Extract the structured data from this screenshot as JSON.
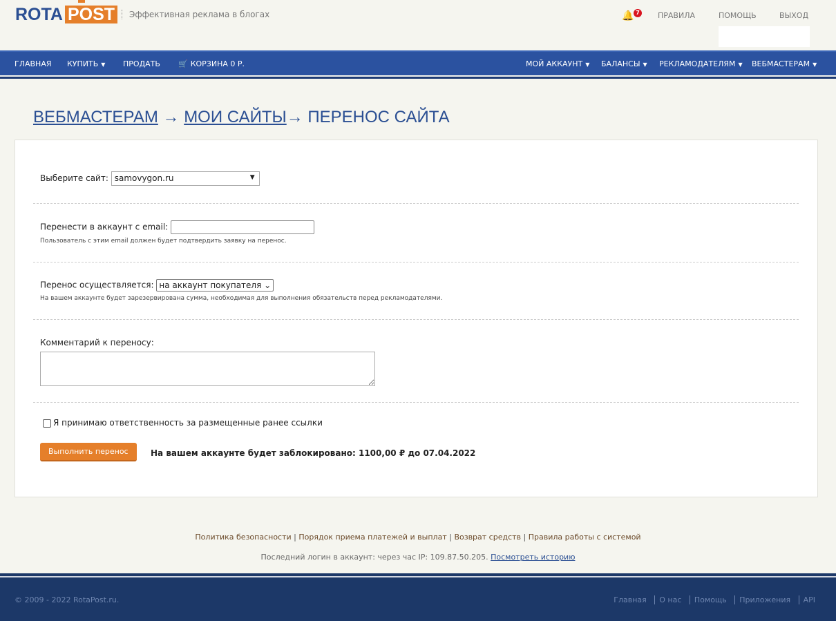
{
  "header": {
    "logo_left": "ROTA",
    "logo_right": "POST",
    "tagline": "Эффективная реклама в блогах",
    "notifications": "7",
    "links": [
      "ПРАВИЛА",
      "ПОМОЩЬ",
      "ВЫХОД"
    ]
  },
  "nav": {
    "left": [
      "ГЛАВНАЯ",
      "КУПИТЬ",
      "ПРОДАТЬ",
      "КОРЗИНА 0 Р."
    ],
    "right": [
      "МОЙ АККАУНТ",
      "БАЛАНСЫ",
      "РЕКЛАМОДАТЕЛЯМ",
      "ВЕБМАСТЕРАМ"
    ]
  },
  "breadcrumb": {
    "b1": "ВЕБМАСТЕРАМ",
    "sep1": " → ",
    "b2": "МОИ САЙТЫ",
    "sep2": "→ ПЕРЕНОС САЙТА"
  },
  "form": {
    "site_label": "Выберите сайт:",
    "site_value": "samovygon.ru",
    "email_label": "Перенести в аккаунт с email:",
    "email_value": "",
    "email_hint": "Пользователь с этим email должен будет подтвердить заявку на перенос.",
    "transfer_label": "Перенос осуществляется:",
    "transfer_value": "на аккаунт покупателя",
    "transfer_hint": "На вашем аккаунте будет зарезервирована сумма, необходимая для выполнения обязательств перед рекламодателями.",
    "comment_label": "Комментарий к переносу:",
    "comment_value": "",
    "accept_label": "Я принимаю ответственность за размещенные ранее ссылки",
    "submit": "Выполнить перенос",
    "blocked": "На вашем аккаунте будет заблокировано: 1100,00 ₽ до 07.04.2022"
  },
  "footer_links": [
    "Политика безопасности",
    "Порядок приема платежей и выплат",
    "Возврат средств",
    "Правила работы с системой"
  ],
  "last_login": {
    "text": "Последний логин в аккаунт: через час IP: 109.87.50.205.",
    "link": "Посмотреть историю"
  },
  "footer": {
    "copyright": "© 2009 - 2022 RotaPost.ru.",
    "links": [
      "Главная",
      "О нас",
      "Помощь",
      "Приложения",
      "API"
    ]
  },
  "colors": {
    "brand_blue": "#2b52a0",
    "brand_orange": "#e57f2a",
    "footer": "#1c3868"
  }
}
